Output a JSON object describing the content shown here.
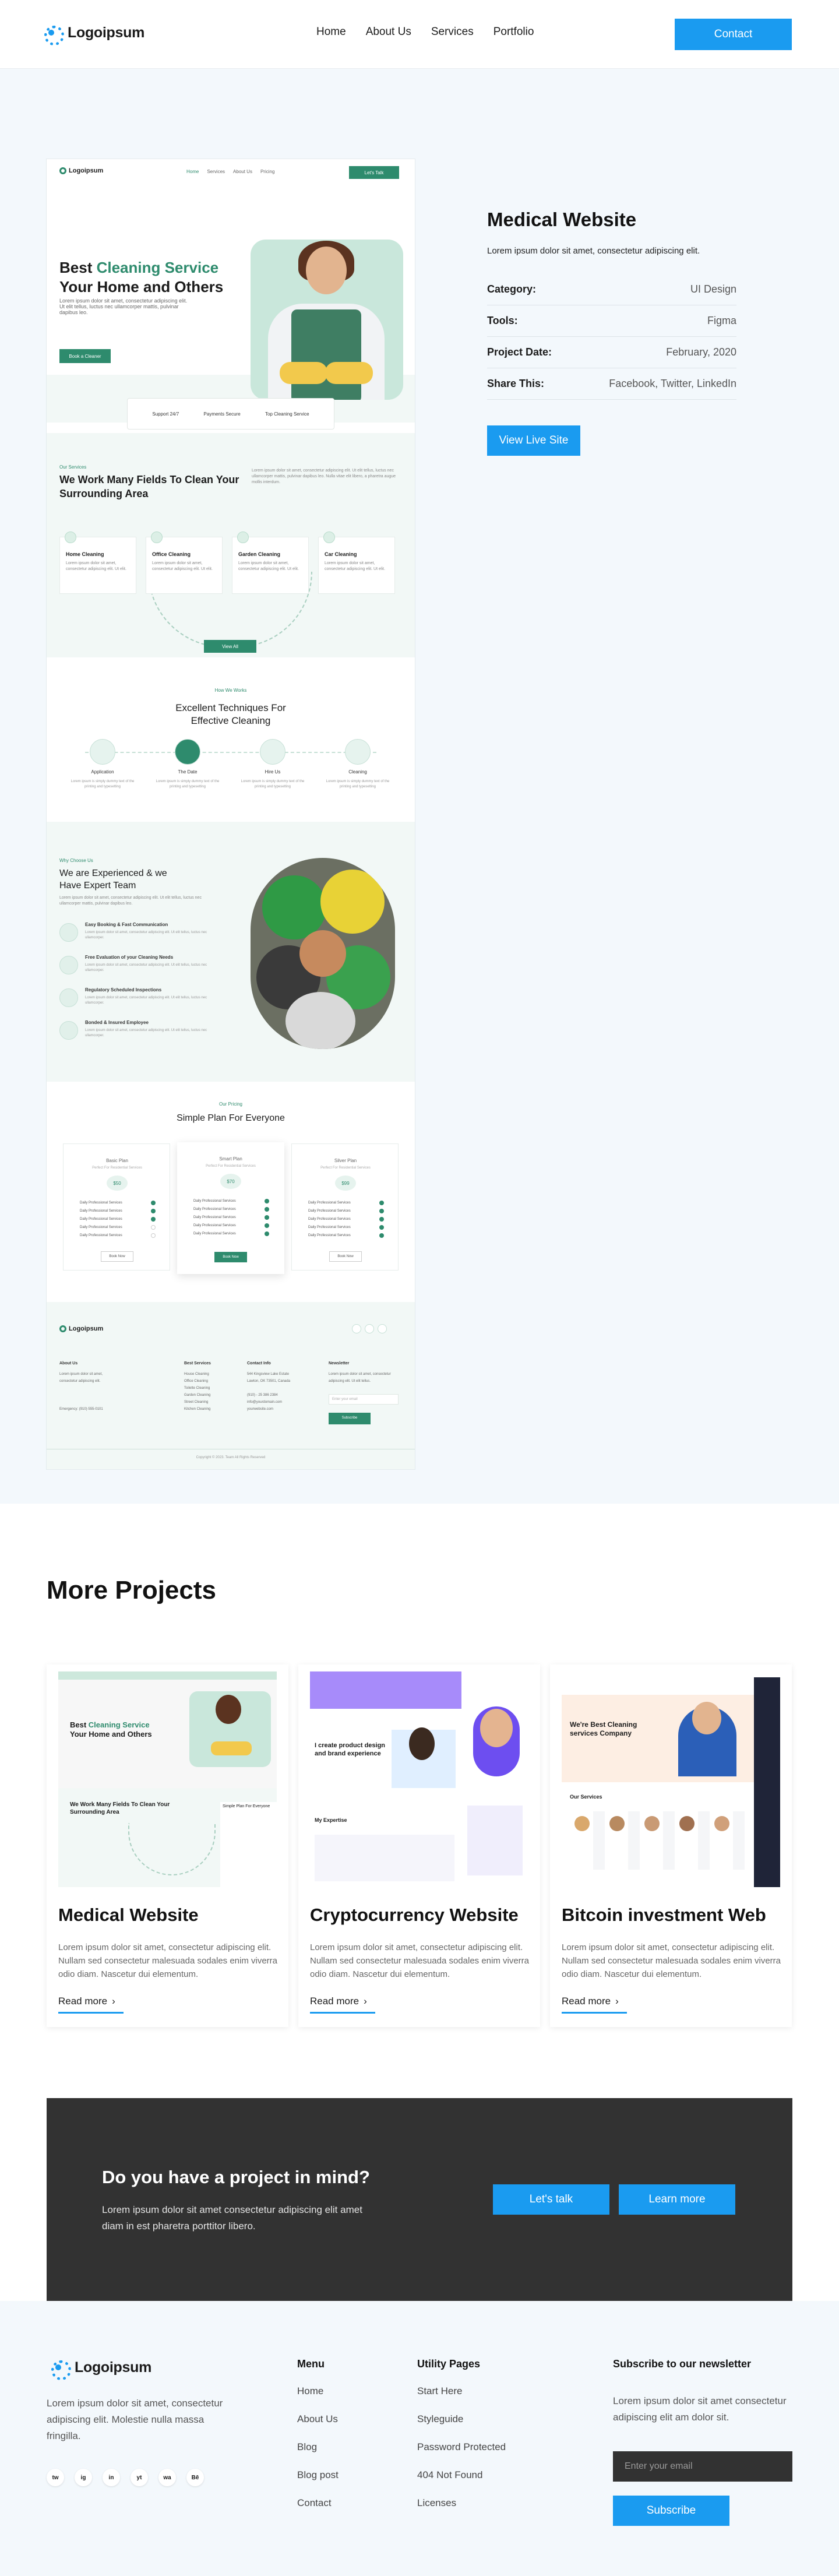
{
  "header": {
    "brand": "Logoipsum",
    "nav": [
      "Home",
      "About Us",
      "Services",
      "Portfolio"
    ],
    "contact": "Contact"
  },
  "project": {
    "title": "Medical Website",
    "subtitle": "Lorem ipsum dolor sit amet, consectetur adipiscing elit.",
    "rows": [
      {
        "k": "Category:",
        "v": "UI Design"
      },
      {
        "k": "Tools:",
        "v": "Figma"
      },
      {
        "k": "Project Date:",
        "v": "February, 2020"
      },
      {
        "k": "Share This:",
        "v": "Facebook, Twitter, LinkedIn"
      }
    ],
    "live": "View Live Site"
  },
  "mock": {
    "logo": "Logoipsum",
    "links": [
      "Home",
      "Services",
      "About Us",
      "Pricing"
    ],
    "cta": "Let's Talk",
    "hero_l1a": "Best ",
    "hero_l1b": "Cleaning Service",
    "hero_l2": "Your Home and Others",
    "hero_p": "Lorem ipsum dolor sit amet, consectetur adipiscing elit. Ut elit tellus, luctus nec ullamcorper mattis, pulvinar dapibus leo.",
    "book": "Book a Cleaner",
    "badges": [
      "Support 24/7",
      "Payments Secure",
      "Top Cleaning Service"
    ],
    "services_tag": "Our Services",
    "services_title": "We Work Many Fields To Clean Your Surrounding Area",
    "services_para": "Lorem ipsum dolor sit amet, consectetur adipiscing elit. Ut elit tellus, luctus nec ullamcorper mattis, pulvinar dapibus leo. Nulla vitae elit libero, a pharetra augue mollis interdum.",
    "cards": [
      {
        "t": "Home Cleaning",
        "d": "Lorem ipsum dolor sit amet, consectetur adipiscing elit. Ut elit."
      },
      {
        "t": "Office Cleaning",
        "d": "Lorem ipsum dolor sit amet, consectetur adipiscing elit. Ut elit."
      },
      {
        "t": "Garden Cleaning",
        "d": "Lorem ipsum dolor sit amet, consectetur adipiscing elit. Ut elit."
      },
      {
        "t": "Car Cleaning",
        "d": "Lorem ipsum dolor sit amet, consectetur adipiscing elit. Ut elit."
      }
    ],
    "view_all": "View All",
    "tech_tag": "How We Works",
    "tech_title1": "Excellent Techniques For",
    "tech_title2": "Effective Cleaning",
    "steps": [
      {
        "t": "Application",
        "d": "Lorem ipsum is simply dummy text of the printing and typesetting"
      },
      {
        "t": "The Date",
        "d": "Lorem ipsum is simply dummy text of the printing and typesetting"
      },
      {
        "t": "Hire Us",
        "d": "Lorem ipsum is simply dummy text of the printing and typesetting"
      },
      {
        "t": "Cleaning",
        "d": "Lorem ipsum is simply dummy text of the printing and typesetting"
      }
    ],
    "exp_tag": "Why Choose Us",
    "exp_title1": "We are Experienced & we",
    "exp_title2": "Have Expert Team",
    "exp_para": "Lorem ipsum dolor sit amet, consectetur adipiscing elit. Ut elit tellus, luctus nec ullamcorper mattis, pulvinar dapibus leo.",
    "features": [
      {
        "t": "Easy Booking & Fast Communication",
        "d": "Lorem ipsum dolor sit amet, consectetur adipiscing elit. Ut elit tellus, luctus nec ullamcorper."
      },
      {
        "t": "Free Evaluation of your Cleaning Needs",
        "d": "Lorem ipsum dolor sit amet, consectetur adipiscing elit. Ut elit tellus, luctus nec ullamcorper."
      },
      {
        "t": "Regulatory Scheduled Inspections",
        "d": "Lorem ipsum dolor sit amet, consectetur adipiscing elit. Ut elit tellus, luctus nec ullamcorper."
      },
      {
        "t": "Bonded & Insured Employee",
        "d": "Lorem ipsum dolor sit amet, consectetur adipiscing elit. Ut elit tellus, luctus nec ullamcorper."
      }
    ],
    "price_tag": "Our Pricing",
    "price_title": "Simple Plan For Everyone",
    "plans": [
      {
        "n": "Basic Plan",
        "s": "Perfect For Residential Services",
        "p": "$50",
        "b": "Book Now",
        "checks": [
          1,
          1,
          1,
          0,
          0
        ]
      },
      {
        "n": "Smart Plan",
        "s": "Perfect For Residential Services",
        "p": "$70",
        "b": "Book Now",
        "checks": [
          1,
          1,
          1,
          1,
          1
        ]
      },
      {
        "n": "Silver Plan",
        "s": "Perfect For Residential Services",
        "p": "$99",
        "b": "Book Now",
        "checks": [
          1,
          1,
          1,
          1,
          1
        ]
      }
    ],
    "plan_item": "Daily Professional Services",
    "foot_logo": "Logoipsum",
    "foot_cols": [
      {
        "h": "About Us",
        "items": [
          "Lorem ipsum dolor sit amet,",
          "consectetur adipiscing elit.",
          "",
          "Emergency: (910) 555-0101"
        ]
      },
      {
        "h": "Best Services",
        "items": [
          "House Cleaning",
          "Office Cleaning",
          "Toilette Cleaning",
          "Garden Cleaning",
          "Street Cleaning",
          "Kitchen Cleaning"
        ]
      },
      {
        "h": "Contact Info",
        "items": [
          "544 Kingsview Lake Estate",
          "Lawton, OK 73501, Canada",
          "",
          "(910) - 25 386 2384",
          "info@yourdomain.com",
          "yourwebsite.com"
        ]
      },
      {
        "h": "Newsletter",
        "items": [
          "Lorem ipsum dolor sit amet, consectetur",
          "adipiscing elit. Ut elit tellus."
        ]
      }
    ],
    "foot_placeholder": "Enter your email",
    "foot_btn": "Subscribe",
    "copyright": "Copyright © 2023. Team All Rights Reserved"
  },
  "more": {
    "title": "More Projects",
    "cards": [
      {
        "title": "Medical Website",
        "desc": "Lorem ipsum dolor sit amet, consectetur adipiscing elit. Nullam sed consectetur malesuada sodales enim viverra odio diam. Nascetur dui elementum.",
        "link": "Read more"
      },
      {
        "title": "Cryptocurrency Website",
        "desc": "Lorem ipsum dolor sit amet, consectetur adipiscing elit. Nullam sed consectetur malesuada sodales enim viverra odio diam. Nascetur dui elementum.",
        "link": "Read more"
      },
      {
        "title": "Bitcoin investment Web",
        "desc": "Lorem ipsum dolor sit amet, consectetur adipiscing elit. Nullam sed consectetur malesuada sodales enim viverra odio diam. Nascetur dui elementum.",
        "link": "Read more"
      }
    ],
    "crypto_title1": "I create product design",
    "crypto_title2": "and brand experience",
    "crypto_sec": "My Expertise",
    "bitcoin_title1": "We're Best Cleaning",
    "bitcoin_title2": "services Company",
    "bitcoin_sec": "Our Services"
  },
  "cta": {
    "title": "Do you have a project in mind?",
    "text": "Lorem ipsum dolor sit amet consectetur adipiscing elit amet diam in est pharetra porttitor libero.",
    "b1": "Let's talk",
    "b2": "Learn more"
  },
  "footer": {
    "brand": "Logoipsum",
    "desc": "Lorem ipsum dolor sit amet, consectetur adipiscing elit. Molestie nulla massa fringilla.",
    "social": [
      "tw",
      "ig",
      "in",
      "yt",
      "wa",
      "Bē"
    ],
    "menu_h": "Menu",
    "menu": [
      "Home",
      "About Us",
      "Blog",
      "Blog post",
      "Contact"
    ],
    "util_h": "Utility Pages",
    "util": [
      "Start Here",
      "Styleguide",
      "Password Protected",
      "404 Not Found",
      "Licenses"
    ],
    "news_h": "Subscribe to our newsletter",
    "news_p": "Lorem ipsum dolor sit amet consectetur adipiscing elit am dolor sit.",
    "placeholder": "Enter your email",
    "subscribe": "Subscribe"
  },
  "colors": {
    "accent": "#1a9bf0",
    "mock_green": "#2e8b6d",
    "dark": "#323232"
  }
}
